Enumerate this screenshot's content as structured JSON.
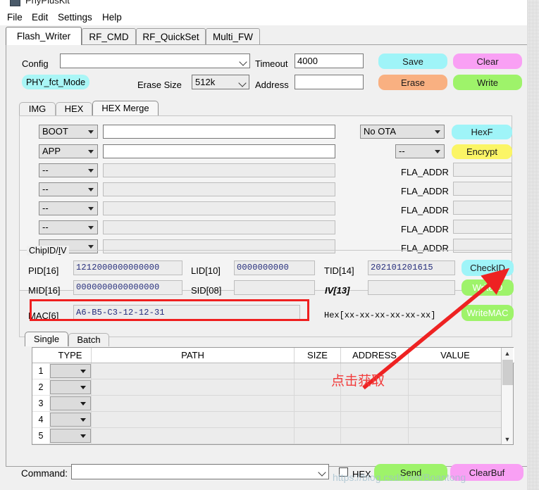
{
  "window": {
    "title": "PhyPlusKit",
    "icon": "app-icon"
  },
  "menubar": {
    "items": [
      {
        "label": "File"
      },
      {
        "label": "Edit"
      },
      {
        "label": "Settings"
      },
      {
        "label": "Help"
      }
    ]
  },
  "tabs": {
    "items": [
      {
        "label": "Flash_Writer",
        "active": true
      },
      {
        "label": "RF_CMD",
        "active": false
      },
      {
        "label": "RF_QuickSet",
        "active": false
      },
      {
        "label": "Multi_FW",
        "active": false
      }
    ]
  },
  "toolbar": {
    "config_label": "Config",
    "config_value": "",
    "timeout_label": "Timeout",
    "timeout_value": "4000",
    "save_label": "Save",
    "save_color": "#9ff4f8",
    "clear_label": "Clear",
    "clear_color": "#f9a0f4",
    "mode_badge": "PHY_fct_Mode",
    "mode_badge_color": "#a9f6f6",
    "erase_size_label": "Erase Size",
    "erase_size_value": "512k",
    "address_label": "Address",
    "address_value": "",
    "erase_label": "Erase",
    "erase_color": "#f9b081",
    "write_label": "Write",
    "write_color": "#9ef36a"
  },
  "hex_tabs": {
    "items": [
      {
        "label": "IMG",
        "active": false
      },
      {
        "label": "HEX",
        "active": false
      },
      {
        "label": "HEX Merge",
        "active": true
      }
    ]
  },
  "merge_rows": [
    {
      "type": "BOOT",
      "path": "",
      "editable": true
    },
    {
      "type": "APP",
      "path": "",
      "editable": true
    },
    {
      "type": "--",
      "path": "",
      "editable": false
    },
    {
      "type": "--",
      "path": "",
      "editable": false
    },
    {
      "type": "--",
      "path": "",
      "editable": false
    },
    {
      "type": "--",
      "path": "",
      "editable": false
    },
    {
      "type": "--",
      "path": "",
      "editable": false
    }
  ],
  "ota": {
    "mode_value": "No OTA",
    "sub_value": "--",
    "hexf_label": "HexF",
    "hexf_color": "#9ff4f8",
    "encrypt_label": "Encrypt",
    "encrypt_color": "#fbf566",
    "fla_addr_label": "FLA_ADDR",
    "fla_addr_rows": [
      {
        "value": ""
      },
      {
        "value": ""
      },
      {
        "value": ""
      },
      {
        "value": ""
      },
      {
        "value": ""
      }
    ]
  },
  "chipid": {
    "group_title_pre": "ChipID/",
    "group_title_u": "I",
    "group_title_post": "V",
    "pid_label": "PID[16]",
    "pid_value": "1212000000000000",
    "lid_label": "LID[10]",
    "lid_value": "0000000000",
    "tid_label": "TID[14]",
    "tid_value": "202101201615",
    "mid_label": "MID[16]",
    "mid_value": "0000000000000000",
    "sid_label": "SID[08]",
    "sid_value": "",
    "iv_label": "IV[13]",
    "iv_value": "",
    "mac_label": "MAC[6]",
    "mac_value": "A6-B5-C3-12-12-31",
    "mac_hint": "Hex[xx-xx-xx-xx-xx-xx]",
    "checkid_label": "CheckID",
    "checkid_color": "#9ff4f8",
    "writeid_label": "WriteID",
    "writeid_color": "#9ef36a",
    "writemac_label": "WriteMAC",
    "writemac_color": "#9ef36a"
  },
  "file_tabs": {
    "items": [
      {
        "label": "Single",
        "active": true
      },
      {
        "label": "Batch",
        "active": false
      }
    ]
  },
  "file_table": {
    "columns": [
      "TYPE",
      "PATH",
      "SIZE",
      "ADDRESS",
      "VALUE"
    ],
    "rows": [
      {
        "index": "1",
        "type": "",
        "path": "",
        "size": "",
        "address": "",
        "value": ""
      },
      {
        "index": "2",
        "type": "",
        "path": "",
        "size": "",
        "address": "",
        "value": ""
      },
      {
        "index": "3",
        "type": "",
        "path": "",
        "size": "",
        "address": "",
        "value": ""
      },
      {
        "index": "4",
        "type": "",
        "path": "",
        "size": "",
        "address": "",
        "value": ""
      },
      {
        "index": "5",
        "type": "",
        "path": "",
        "size": "",
        "address": "",
        "value": ""
      }
    ]
  },
  "command_bar": {
    "label": "Command:",
    "value": "",
    "hex_label": "HEX",
    "hex_checked": false,
    "send_label": "Send",
    "send_color": "#9ef36a",
    "clearbuf_label": "ClearBuf",
    "clearbuf_color": "#f9a0f4"
  },
  "annotations": {
    "click_to_get": "点击获取",
    "annotation_color": "#f23b3b",
    "watermark": "https://blog.csdn.net/Boantong"
  }
}
